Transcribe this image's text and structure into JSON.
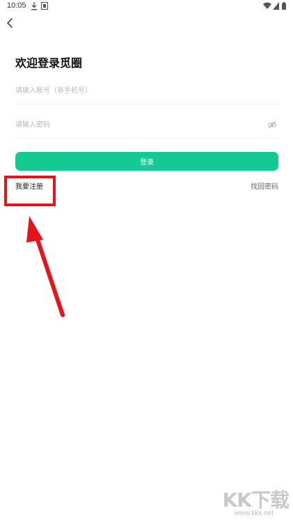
{
  "status_bar": {
    "time": "10:05",
    "left_icons": [
      "download-icon",
      "notification-icon"
    ],
    "right_icons": [
      "wifi-icon",
      "signal-icon",
      "battery-icon"
    ]
  },
  "nav": {
    "back_icon": "back-arrow-icon"
  },
  "login": {
    "title": "欢迎登录觅圈",
    "account_placeholder": "请输入账号（非手机号）",
    "password_placeholder": "请输入密码",
    "submit_label": "登录",
    "register_label": "我要注册",
    "forgot_label": "找回密码"
  },
  "watermark": {
    "brand": "KK下载",
    "url": "www.kkx.net"
  },
  "colors": {
    "accent": "#15c993",
    "annotation": "#e8121a"
  }
}
